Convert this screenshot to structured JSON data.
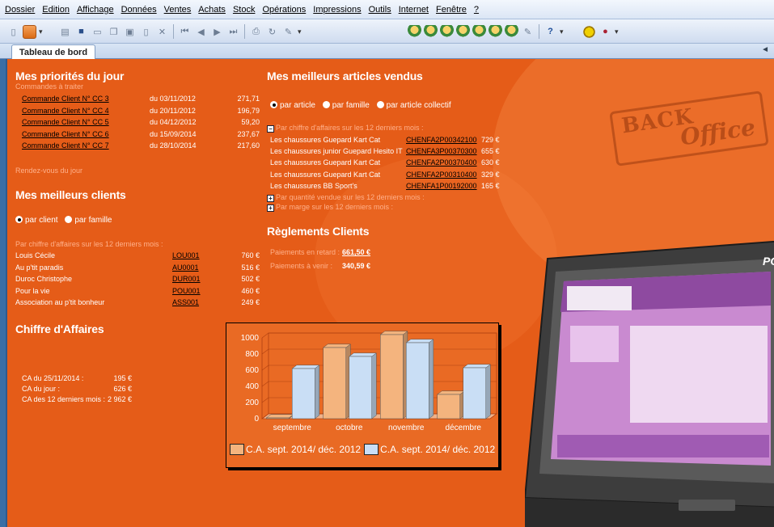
{
  "menu": [
    "Dossier",
    "Edition",
    "Affichage",
    "Données",
    "Ventes",
    "Achats",
    "Stock",
    "Opérations",
    "Impressions",
    "Outils",
    "Internet",
    "Fenêtre",
    "?"
  ],
  "toolbar": {
    "help_label": "?"
  },
  "tabs": {
    "active": "Tableau de bord",
    "nav_arrow": "◄"
  },
  "priorites": {
    "title": "Mes priorités du jour",
    "subtitle": "Commandes à traiter",
    "orders": [
      {
        "label": "Commande Client N° CC 3",
        "date": "du 03/11/2012",
        "amount": "271,71"
      },
      {
        "label": "Commande Client N° CC 4",
        "date": "du 20/11/2012",
        "amount": "196,79"
      },
      {
        "label": "Commande Client N° CC 5",
        "date": "du 04/12/2012",
        "amount": "59,20"
      },
      {
        "label": "Commande Client N° CC 6",
        "date": "du 15/09/2014",
        "amount": "237,67"
      },
      {
        "label": "Commande Client N° CC 7",
        "date": "du 28/10/2014",
        "amount": "217,60"
      }
    ],
    "rdv": "Rendez-vous du jour"
  },
  "clients": {
    "title": "Mes meilleurs clients",
    "radio1": "par client",
    "radio2": "par famille",
    "subtitle": "Par chiffre d'affaires sur les 12 derniers mois :",
    "rows": [
      {
        "name": "Louis Cécile",
        "code": "LOU001",
        "amount": "760 €"
      },
      {
        "name": "Au p'tit paradis",
        "code": "AU0001",
        "amount": "516 €"
      },
      {
        "name": "Duroc Christophe",
        "code": "DUR001",
        "amount": "502 €"
      },
      {
        "name": "Pour la vie",
        "code": "POU001",
        "amount": "460 €"
      },
      {
        "name": "Association au p'tit bonheur",
        "code": "ASS001",
        "amount": "249 €"
      }
    ]
  },
  "ca": {
    "title": "Chiffre d'Affaires",
    "rows": [
      {
        "label": "CA du 25/11/2014 :",
        "value": "195 €"
      },
      {
        "label": "CA du jour :",
        "value": "626 €"
      },
      {
        "label": "CA des 12 derniers mois :",
        "value": "2 962 €"
      }
    ]
  },
  "articles": {
    "title": "Mes meilleurs articles vendus",
    "radio1": "par article",
    "radio2": "par famille",
    "radio3": "par article collectif",
    "section1": "Par chiffre d'affaires sur les 12 derniers mois :",
    "rows": [
      {
        "name": "Les chaussures Guepard Kart Cat",
        "code": "CHENFA2P00342100",
        "amount": "729 €"
      },
      {
        "name": "Les chaussures junior Guepard Hesito IT",
        "code": "CHENFA3P00370300",
        "amount": "655 €"
      },
      {
        "name": "Les chaussures Guepard Kart Cat",
        "code": "CHENFA2P00370400",
        "amount": "630 €"
      },
      {
        "name": "Les chaussures Guepard Kart Cat",
        "code": "CHENFA2P00310400",
        "amount": "329 €"
      },
      {
        "name": "Les chaussures BB Sport's",
        "code": "CHENFA1P00192000",
        "amount": "165 €"
      }
    ],
    "section2": "Par quantité vendue sur les 12 derniers mois :",
    "section3": "Par marge sur les 12 derniers mois :"
  },
  "reglements": {
    "title": "Règlements Clients",
    "retard_label": "Paiements en retard :",
    "retard_value": "661,50 €",
    "avenir_label": "Paiements à venir :",
    "avenir_value": "340,59 €"
  },
  "stamp": {
    "line1": "BACK",
    "line2": "Office"
  },
  "pos_brand": "POS",
  "chart_data": {
    "type": "bar",
    "categories": [
      "septembre",
      "octobre",
      "novembre",
      "décembre"
    ],
    "series": [
      {
        "name": "C.A. sept. 2014/ déc. 2012",
        "values": [
          10,
          880,
          1040,
          300
        ],
        "color": "#f4b47e"
      },
      {
        "name": "C.A. sept. 2014/ déc. 2012",
        "values": [
          620,
          770,
          940,
          630
        ],
        "color": "#c9def5"
      }
    ],
    "ylim": [
      0,
      1000
    ],
    "yticks": [
      0,
      200,
      400,
      600,
      800,
      1000
    ],
    "grid": true,
    "legend": "bottom"
  }
}
